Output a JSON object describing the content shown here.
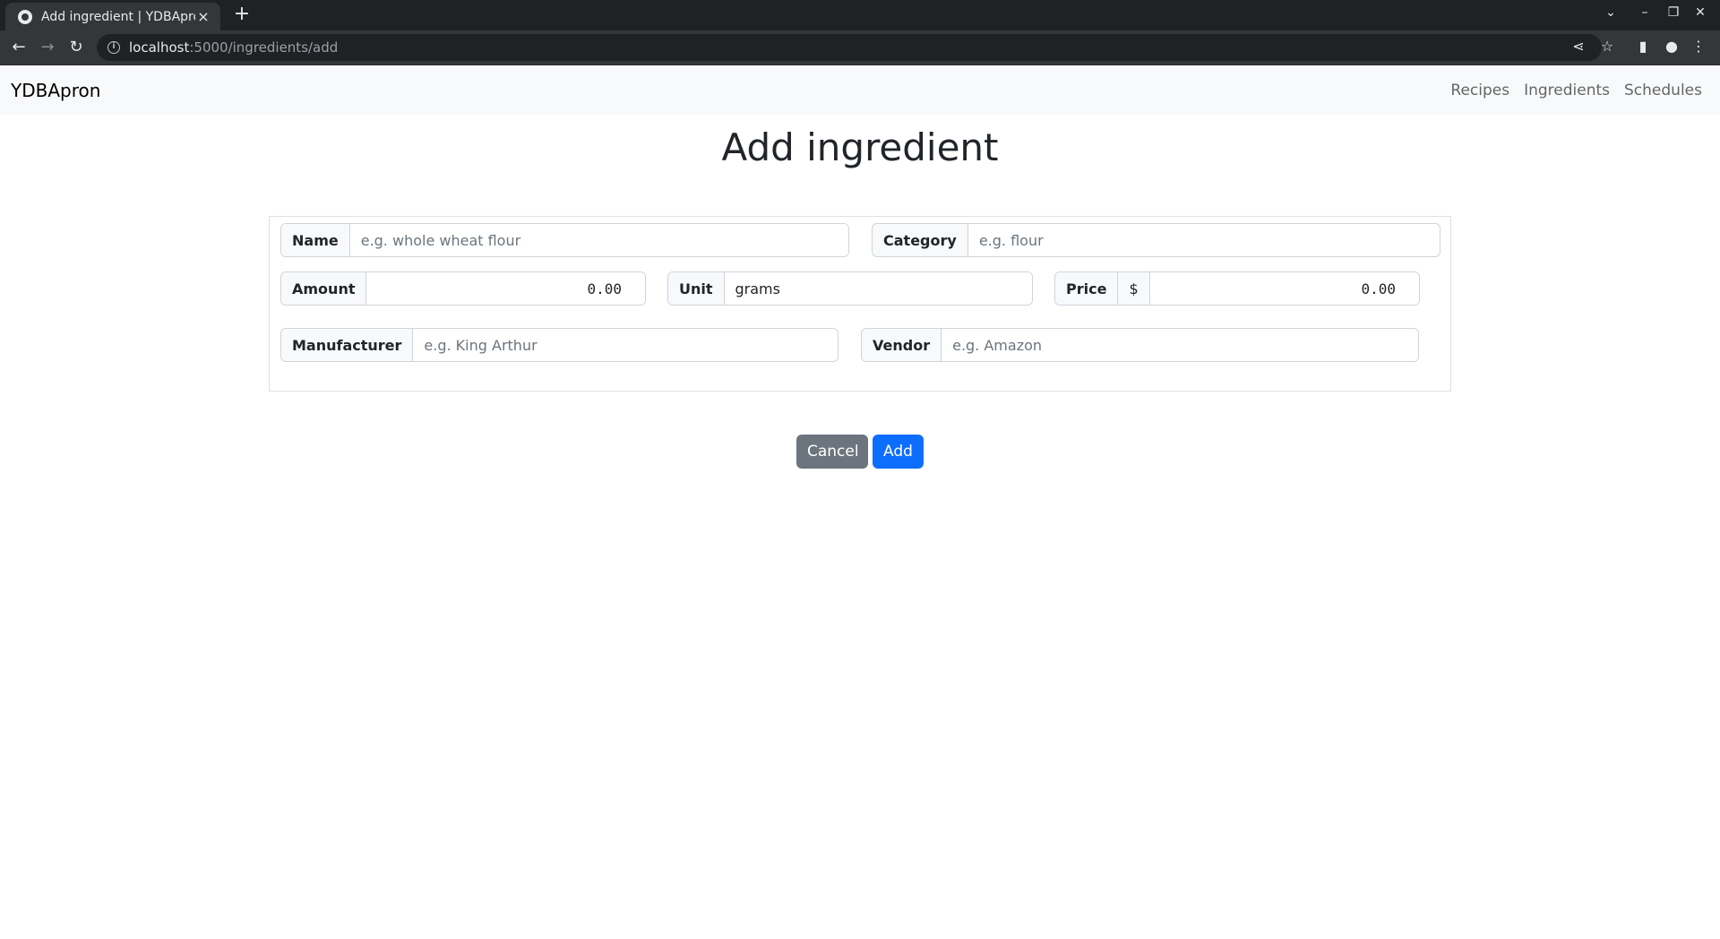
{
  "browser": {
    "tab_title": "Add ingredient | YDBApron",
    "url_host": "localhost",
    "url_rest": ":5000/ingredients/add"
  },
  "navbar": {
    "brand": "YDBApron",
    "links": [
      "Recipes",
      "Ingredients",
      "Schedules"
    ]
  },
  "page": {
    "title": "Add ingredient"
  },
  "form": {
    "name": {
      "label": "Name",
      "placeholder": "e.g. whole wheat flour",
      "value": ""
    },
    "category": {
      "label": "Category",
      "placeholder": "e.g. flour",
      "value": ""
    },
    "amount": {
      "label": "Amount",
      "value": "0.00"
    },
    "unit": {
      "label": "Unit",
      "value": "grams"
    },
    "price": {
      "label": "Price",
      "currency": "$",
      "value": "0.00"
    },
    "manufacturer": {
      "label": "Manufacturer",
      "placeholder": "e.g. King Arthur",
      "value": ""
    },
    "vendor": {
      "label": "Vendor",
      "placeholder": "e.g. Amazon",
      "value": ""
    }
  },
  "buttons": {
    "cancel": "Cancel",
    "add": "Add"
  },
  "colors": {
    "primary": "#0d6efd",
    "secondary": "#6c757d",
    "navbar_bg": "#f8f9fa"
  }
}
